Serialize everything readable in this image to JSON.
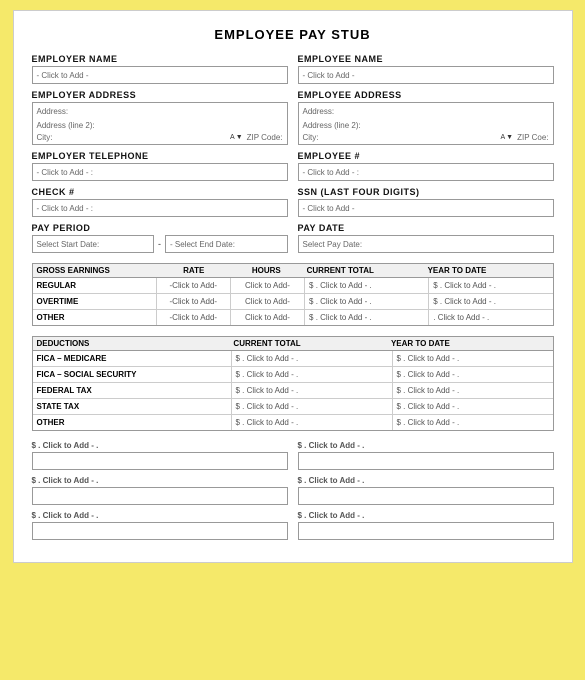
{
  "title": "EMPLOYEE PAY STUB",
  "employer": {
    "name_label": "EMPLOYER NAME",
    "name_placeholder": "- Click to Add -",
    "address_label": "EMPLOYER ADDRESS",
    "address_line1": "Address:",
    "address_line2": "Address (line 2):",
    "city_label": "City:",
    "state": "A",
    "zip_label": "ZIP Code:",
    "telephone_label": "EMPLOYER TELEPHONE",
    "telephone_placeholder": "- Click to Add - :"
  },
  "employee": {
    "name_label": "EMPLOYEE NAME",
    "name_placeholder": "- Click to Add -",
    "address_label": "EMPLOYEE ADDRESS",
    "address_line1": "Address:",
    "address_line2": "Address (line 2):",
    "city_label": "City:",
    "state": "A",
    "zip_label": "ZIP Coe:",
    "number_label": "EMPLOYEE #",
    "number_placeholder": "- Click to Add - :"
  },
  "check": {
    "label": "CHECK #",
    "placeholder": "- Click to Add - :"
  },
  "ssn": {
    "label": "SSN (LAST FOUR DIGITS)",
    "placeholder": "- Click to Add -"
  },
  "pay_period": {
    "label": "PAY PERIOD",
    "start_placeholder": "Select Start Date:",
    "end_placeholder": "- Select End Date:"
  },
  "pay_date": {
    "label": "PAY DATE",
    "placeholder": "Select Pay Date:"
  },
  "earnings": {
    "header": {
      "gross": "GROSS EARNINGS",
      "rate": "RATE",
      "hours": "HOURS",
      "current": "CURRENT TOTAL",
      "ytd": "YEAR TO DATE"
    },
    "rows": [
      {
        "label": "REGULAR",
        "rate": "-Click to Add-",
        "hours": "Click to Add-",
        "current": "$ . Click to Add - .",
        "ytd": "$ . Click to Add - ."
      },
      {
        "label": "OVERTIME",
        "rate": "-Click to Add-",
        "hours": "Click to Add-",
        "current": "$ . Click to Add - .",
        "ytd": "$ . Click to Add - ."
      },
      {
        "label": "OTHER",
        "rate": "-Click to Add-",
        "hours": "Click to Add-",
        "current": "$ . Click to Add - .",
        "ytd": ". Click to Add - ."
      }
    ]
  },
  "deductions": {
    "header": {
      "label": "DEDUCTIONS",
      "current": "CURRENT TOTAL",
      "ytd": "YEAR TO DATE"
    },
    "rows": [
      {
        "label": "FICA – MEDICARE",
        "current": "$ . Click to Add - .",
        "ytd": "$ . Click to Add - ."
      },
      {
        "label": "FICA – SOCIAL SECURITY",
        "current": "$ . Click to Add - .",
        "ytd": "$ . Click to Add - ."
      },
      {
        "label": "FEDERAL TAX",
        "current": "$ . Click to Add - .",
        "ytd": "$ . Click to Add - ."
      },
      {
        "label": "STATE TAX",
        "current": "$ . Click to Add - .",
        "ytd": "$ . Click to Add - ."
      },
      {
        "label": "OTHER",
        "current": "$ . Click to Add - .",
        "ytd": "$ . Click to Add - ."
      }
    ]
  },
  "summary": {
    "left": {
      "label1": "$ . Click to Add - .",
      "label2": "$ . Click to Add - .",
      "label3": "$ . Click to Add - ."
    },
    "right": {
      "label1": "$ . Click to Add - .",
      "label2": "$ . Click to Add - .",
      "label3": "$ . Click to Add - ."
    }
  }
}
